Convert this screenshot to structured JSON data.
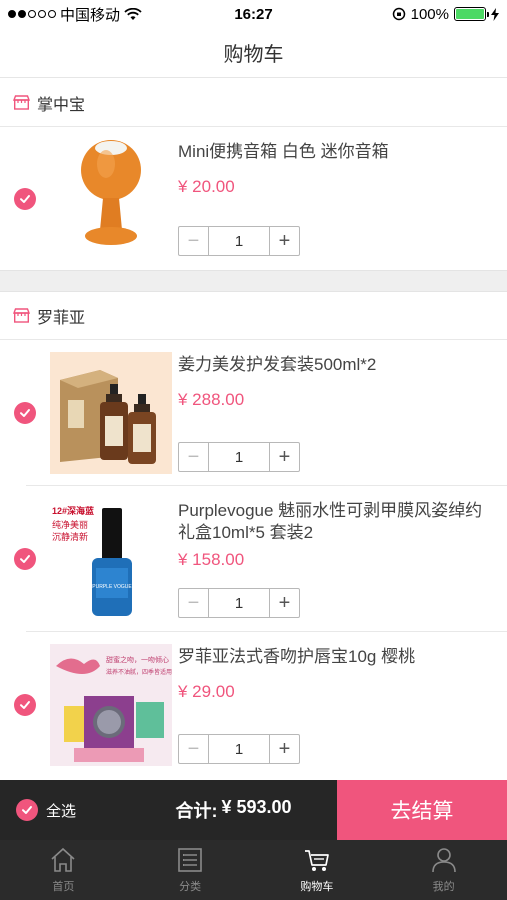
{
  "status_bar": {
    "carrier": "中国移动",
    "time": "16:27",
    "battery": "100%",
    "battery_level": 1.0,
    "signal_bars_filled": 2,
    "signal_bars_total": 5
  },
  "nav": {
    "title": "购物车"
  },
  "shops": [
    {
      "name": "掌中宝",
      "items": [
        {
          "title": "Mini便携音箱 白色 迷你音箱",
          "price": "¥ 20.00",
          "quantity": "1",
          "selected": true
        }
      ]
    },
    {
      "name": "罗菲亚",
      "items": [
        {
          "title": "姜力美发护发套装500ml*2",
          "price": "¥ 288.00",
          "quantity": "1",
          "selected": true
        },
        {
          "title": "Purplevogue  魅丽水性可剥甲膜风姿绰约礼盒10ml*5 套装2",
          "price": "¥ 158.00",
          "quantity": "1",
          "selected": true
        },
        {
          "title": "罗菲亚法式香吻护唇宝10g 樱桃",
          "price": "¥ 29.00",
          "quantity": "1",
          "selected": true
        }
      ]
    }
  ],
  "stepper": {
    "minus": "−",
    "plus": "+"
  },
  "checkout": {
    "select_all_label": "全选",
    "total_label": "合计:",
    "total_value": "¥ 593.00",
    "checkout_label": "去结算"
  },
  "tabs": [
    {
      "label": "首页",
      "icon": "home-icon",
      "active": false
    },
    {
      "label": "分类",
      "icon": "list-icon",
      "active": false
    },
    {
      "label": "购物车",
      "icon": "cart-icon",
      "active": true
    },
    {
      "label": "我的",
      "icon": "user-icon",
      "active": false
    }
  ],
  "product_image_text": {
    "polish_brand": "12#深海蓝",
    "polish_tag_1": "纯净美丽",
    "polish_tag_2": "沉静清新",
    "polish_bottle": "PURPLE VOGUE",
    "lip_tag_1": "甜蜜之吻，一吻倾心",
    "lip_tag_2": "滋养不油腻，四季皆适用"
  },
  "colors": {
    "accent": "#f0557d",
    "bar_dark": "#262626",
    "tab_dark": "#2b2b2b",
    "battery_green": "#4cd964"
  }
}
